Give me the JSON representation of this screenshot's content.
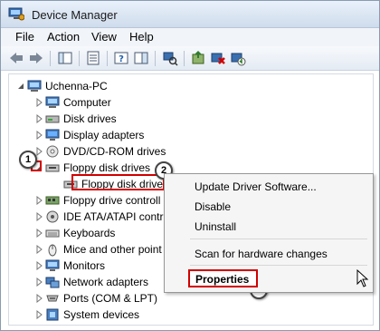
{
  "window": {
    "title": "Device Manager"
  },
  "menu": [
    "File",
    "Action",
    "View",
    "Help"
  ],
  "tree": {
    "root": "Uchenna-PC",
    "items": [
      "Computer",
      "Disk drives",
      "Display adapters",
      "DVD/CD-ROM drives",
      "Floppy disk drives",
      "Floppy disk drive",
      "Floppy drive controll",
      "IDE ATA/ATAPI contr",
      "Keyboards",
      "Mice and other point",
      "Monitors",
      "Network adapters",
      "Ports (COM & LPT)",
      "System devices"
    ]
  },
  "context_menu": {
    "items": [
      "Update Driver Software...",
      "Disable",
      "Uninstall",
      "Scan for hardware changes"
    ],
    "properties": "Properties"
  },
  "callouts": [
    "1",
    "2",
    "3"
  ],
  "colors": {
    "highlight": "#d10000",
    "accent": "#2b5797"
  }
}
